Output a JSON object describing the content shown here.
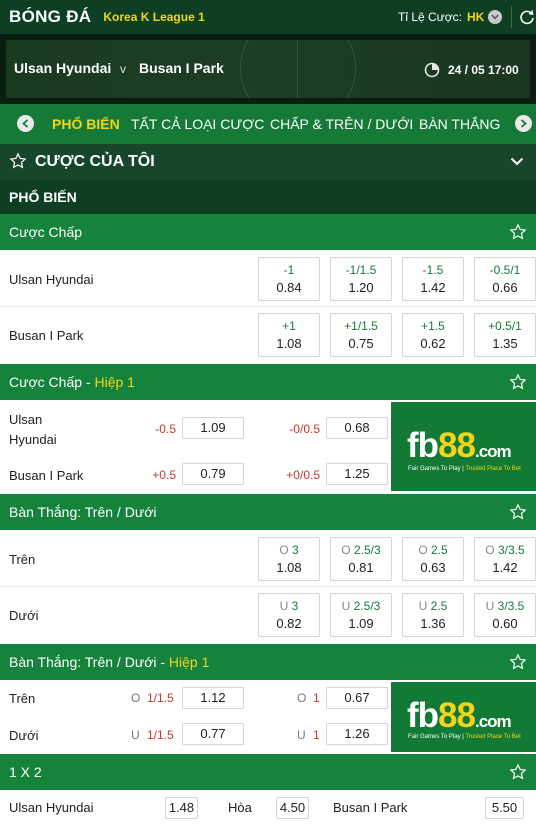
{
  "topbar": {
    "sport": "BÓNG ĐÁ",
    "league": "Korea K League 1",
    "odds_label": "Tỉ Lệ Cược:",
    "odds_value": "HK"
  },
  "match": {
    "home": "Ulsan Hyundai",
    "vs": "v",
    "away": "Busan I Park",
    "datetime": "24 / 05  17:00"
  },
  "tabs": [
    {
      "label": "PHỔ BIẾN",
      "active": true
    },
    {
      "label": "TẤT CẢ LOẠI CƯỢC",
      "active": false
    },
    {
      "label": "CHẤP & TRÊN / DƯỚI",
      "active": false
    },
    {
      "label": "BÀN THẮNG",
      "active": false
    }
  ],
  "mybets": {
    "title": "CƯỢC CỦA TÔI"
  },
  "popular": {
    "title": "PHỔ BIẾN"
  },
  "handicap": {
    "title": "Cược Chấp",
    "rows": [
      {
        "team": "Ulsan Hyundai",
        "cells": [
          {
            "h": "-1",
            "o": "0.84"
          },
          {
            "h": "-1/1.5",
            "o": "1.20"
          },
          {
            "h": "-1.5",
            "o": "1.42"
          },
          {
            "h": "-0.5/1",
            "o": "0.66"
          }
        ]
      },
      {
        "team": "Busan I Park",
        "cells": [
          {
            "h": "+1",
            "o": "1.08"
          },
          {
            "h": "+1/1.5",
            "o": "0.75"
          },
          {
            "h": "+1.5",
            "o": "0.62"
          },
          {
            "h": "+0.5/1",
            "o": "1.35"
          }
        ]
      }
    ]
  },
  "handicap_h1": {
    "title": "Cược Chấp - ",
    "half": "Hiệp 1",
    "rows": [
      {
        "team": "Ulsan Hyundai",
        "c1": "-0.5",
        "o1": "1.09",
        "c2": "-0/0.5",
        "o2": "0.68"
      },
      {
        "team": "Busan I Park",
        "c1": "+0.5",
        "o1": "0.79",
        "c2": "+0/0.5",
        "o2": "1.25"
      }
    ]
  },
  "totals": {
    "title": "Bàn Thắng: Trên / Dưới",
    "rows": [
      {
        "label": "Trên",
        "cells": [
          {
            "p": "O",
            "h": "3",
            "o": "1.08"
          },
          {
            "p": "O",
            "h": "2.5/3",
            "o": "0.81"
          },
          {
            "p": "O",
            "h": "2.5",
            "o": "0.63"
          },
          {
            "p": "O",
            "h": "3/3.5",
            "o": "1.42"
          }
        ]
      },
      {
        "label": "Dưới",
        "cells": [
          {
            "p": "U",
            "h": "3",
            "o": "0.82"
          },
          {
            "p": "U",
            "h": "2.5/3",
            "o": "1.09"
          },
          {
            "p": "U",
            "h": "2.5",
            "o": "1.36"
          },
          {
            "p": "U",
            "h": "3/3.5",
            "o": "0.60"
          }
        ]
      }
    ]
  },
  "totals_h1": {
    "title": "Bàn Thắng: Trên / Dưới - ",
    "half": "Hiệp 1",
    "rows": [
      {
        "label": "Trên",
        "p1": "O",
        "h1": "1/1.5",
        "o1": "1.12",
        "p2": "O",
        "h2": "1",
        "o2": "0.67"
      },
      {
        "label": "Dưới",
        "p1": "U",
        "h1": "1/1.5",
        "o1": "0.77",
        "p2": "U",
        "h2": "1",
        "o2": "1.26"
      }
    ]
  },
  "x12": {
    "title": "1 X 2",
    "home": "Ulsan Hyundai",
    "home_odds": "1.48",
    "draw": "Hòa",
    "draw_odds": "4.50",
    "away": "Busan I Park",
    "away_odds": "5.50"
  },
  "banner": {
    "brand_a": "fb",
    "brand_b": "88",
    "brand_c": ".com",
    "tag_a": "Fair Games To Play",
    "tag_b": "Trusted Place To Bet"
  },
  "colors": {
    "dark_green": "#0e3f22",
    "green": "#15833b",
    "yellow": "#f2d51b",
    "red": "#c0392b"
  }
}
